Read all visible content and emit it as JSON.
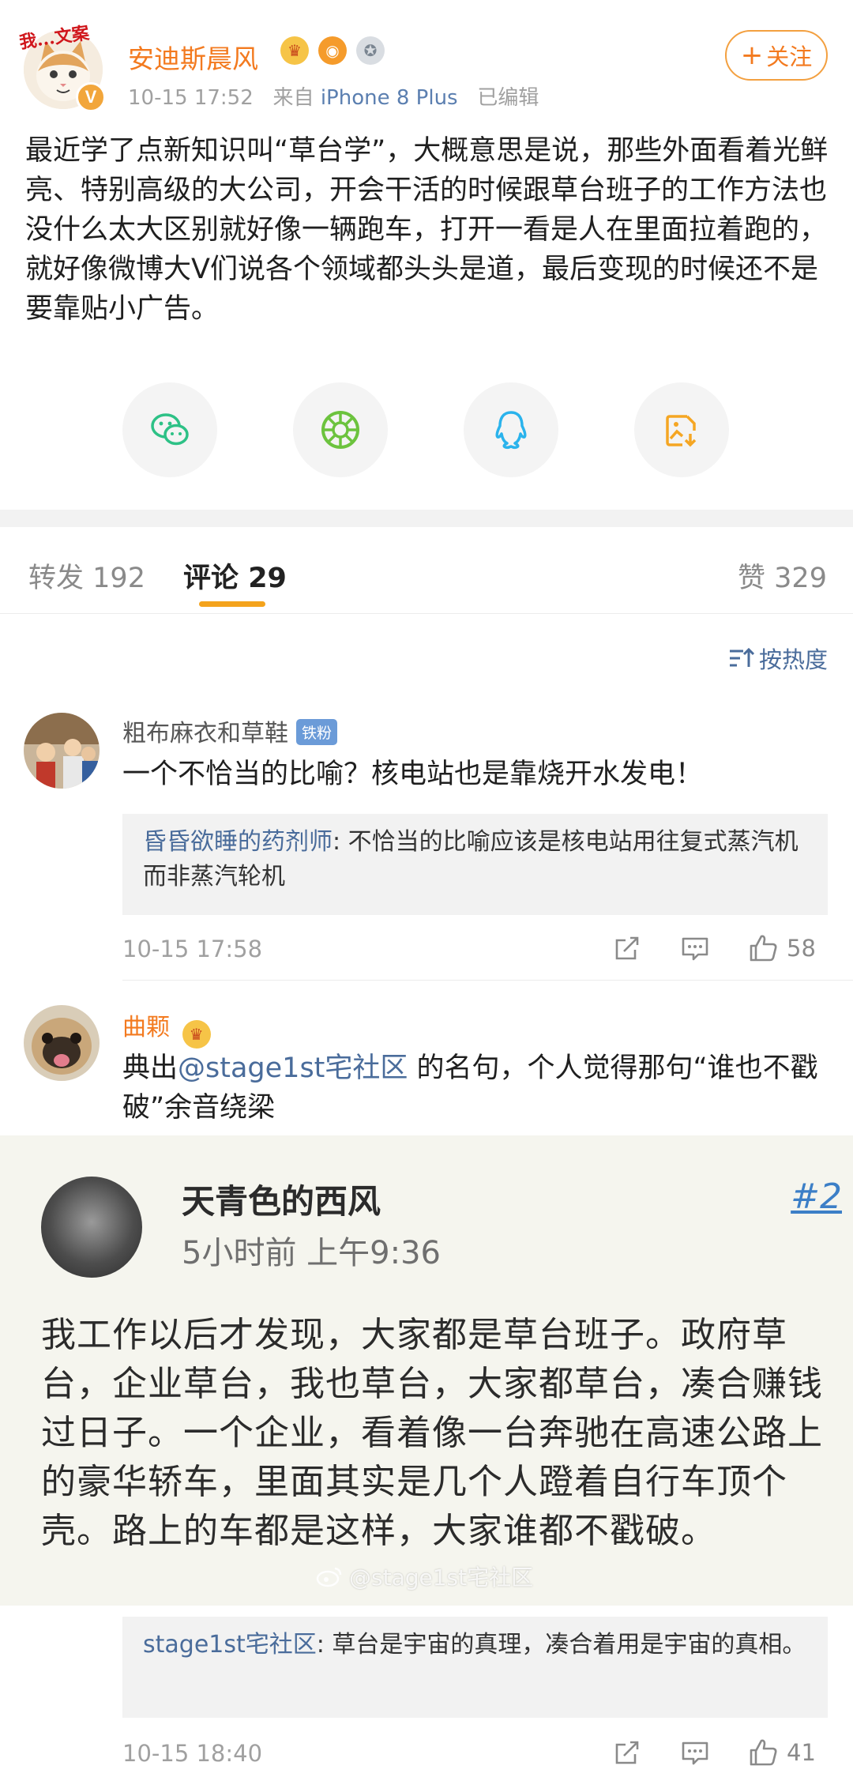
{
  "post": {
    "author": "安迪斯晨风",
    "avatar_caption": "我...文案",
    "verified_mark": "V",
    "time": "10-15 17:52",
    "source_prefix": "来自",
    "source_device": "iPhone 8 Plus",
    "edited": "已编辑",
    "follow_label": "关注",
    "follow_plus": "+",
    "text": "最近学了点新知识叫“草台学”，大概意思是说，那些外面看着光鲜亮、特别高级的大公司，开会干活的时候跟草台班子的工作方法也没什么太大区别就好像一辆跑车，打开一看是人在里面拉着跑的，就好像微博大V们说各个领域都头头是道，最后变现的时候还不是要靠贴小广告。",
    "share_buttons": [
      "wechat-icon",
      "moments-icon",
      "qq-icon",
      "save-image-icon"
    ]
  },
  "tabs": {
    "repost_label": "转发",
    "repost_count": "192",
    "comment_label": "评论",
    "comment_count": "29",
    "like_label": "赞",
    "like_count": "329"
  },
  "sort_label": "按热度",
  "comments": [
    {
      "name": "粗布麻衣和草鞋",
      "badge": "铁粉",
      "text": "一个不恰当的比喻？核电站也是靠烧开水发电！",
      "reply_name": "昏昏欲睡的药剂师",
      "reply_text": ": 不恰当的比喻应该是核电站用往复式蒸汽机而非蒸汽轮机",
      "time": "10-15 17:58",
      "likes": "58"
    },
    {
      "name": "曲颗",
      "text_prefix": "典出",
      "mention": "@stage1st宅社区",
      "text_suffix": " 的名句，个人觉得那句“谁也不戳破”余音绕梁",
      "embed": {
        "name": "天青色的西风",
        "time": "5小时前 上午9:36",
        "floor": "#2",
        "text": "我工作以后才发现，大家都是草台班子。政府草台，企业草台，我也草台，大家都草台，凑合赚钱过日子。一个企业，看着像一台奔驰在高速公路上的豪华轿车，里面其实是几个人蹬着自行车顶个壳。路上的车都是这样，大家谁都不戳破。",
        "watermark": "@stage1st宅社区"
      },
      "reply_name": "stage1st宅社区",
      "reply_text": ": 草台是宇宙的真理，凑合着用是宇宙的真相。",
      "time": "10-15 18:40",
      "likes": "41"
    }
  ],
  "colors": {
    "accent_orange": "#f37a1f",
    "link_blue": "#4a6c9b",
    "tab_underline": "#f4a31c",
    "wechat_green": "#2dc186",
    "moments_green": "#6cc33e",
    "qq_blue": "#2ab3ec",
    "save_orange": "#f5a623"
  }
}
